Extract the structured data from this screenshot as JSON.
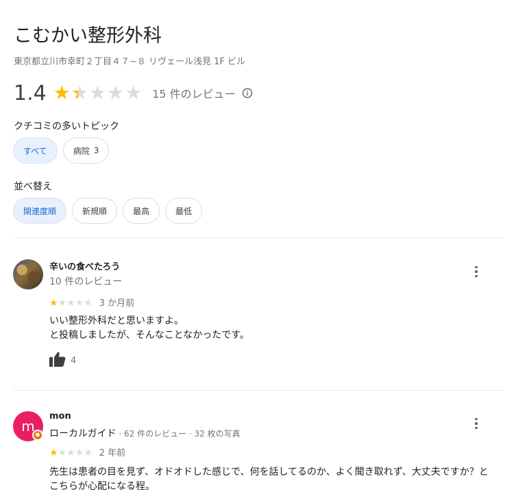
{
  "place": {
    "name": "こむかい整形外科",
    "address": "東京都立川市幸町２丁目４７−８ リヴェール浅見 1F ビル"
  },
  "rating": {
    "value": "1.4",
    "stars_fraction": 0.28,
    "review_count_text": "15 件のレビュー"
  },
  "topics": {
    "label": "クチコミの多いトピック",
    "chips": [
      {
        "label": "すべて",
        "count": "",
        "selected": true
      },
      {
        "label": "病院",
        "count": "3",
        "selected": false
      }
    ]
  },
  "sort": {
    "label": "並べ替え",
    "chips": [
      {
        "label": "関連度順",
        "selected": true
      },
      {
        "label": "新規順",
        "selected": false
      },
      {
        "label": "最高",
        "selected": false
      },
      {
        "label": "最低",
        "selected": false
      }
    ]
  },
  "reviews": [
    {
      "name": "辛いの食べたろう",
      "meta": "10 件のレビュー",
      "stars": 1,
      "date": "3 か月前",
      "text_lines": [
        "いい整形外科だと思いますよ。",
        "と投稿しましたが、そんなことなかったです。"
      ],
      "likes": "4"
    },
    {
      "name": "mon",
      "avatar_letter": "m",
      "local_guide": "ローカルガイド",
      "meta_rest": " · 62 件のレビュー · 32 枚の写真",
      "stars": 1,
      "date": "2 年前",
      "text_lines": [
        "先生は患者の目を見ず、オドオドした感じで、何を話してるのか、よく聞き取れず、大丈夫ですか？と",
        "こちらが心配になる程。"
      ]
    }
  ],
  "colors": {
    "star_filled": "#fbbc04",
    "star_empty": "#dadce0",
    "chip_selected_bg": "#e8f0fe",
    "chip_selected_text": "#1967d2",
    "avatar_mon": "#e91e63",
    "local_guide_badge": "#e8710a"
  },
  "icons": [
    "info-icon",
    "more-vert-icon",
    "thumb-up-icon",
    "local-guide-badge-icon"
  ]
}
